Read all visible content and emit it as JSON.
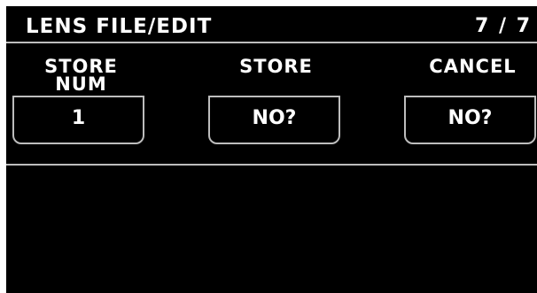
{
  "header": {
    "title": "LENS FILE/EDIT",
    "page_indicator": "7 / 7"
  },
  "params": [
    {
      "label_line1": "STORE",
      "label_line2": "NUM",
      "value": "1"
    },
    {
      "label_line1": "",
      "label_line2": "STORE",
      "value": "NO?"
    },
    {
      "label_line1": "",
      "label_line2": "CANCEL",
      "value": "NO?"
    }
  ],
  "colors": {
    "background": "#000000",
    "text": "#ffffff",
    "border": "#bdbdbd",
    "outer": "#ffffff"
  }
}
